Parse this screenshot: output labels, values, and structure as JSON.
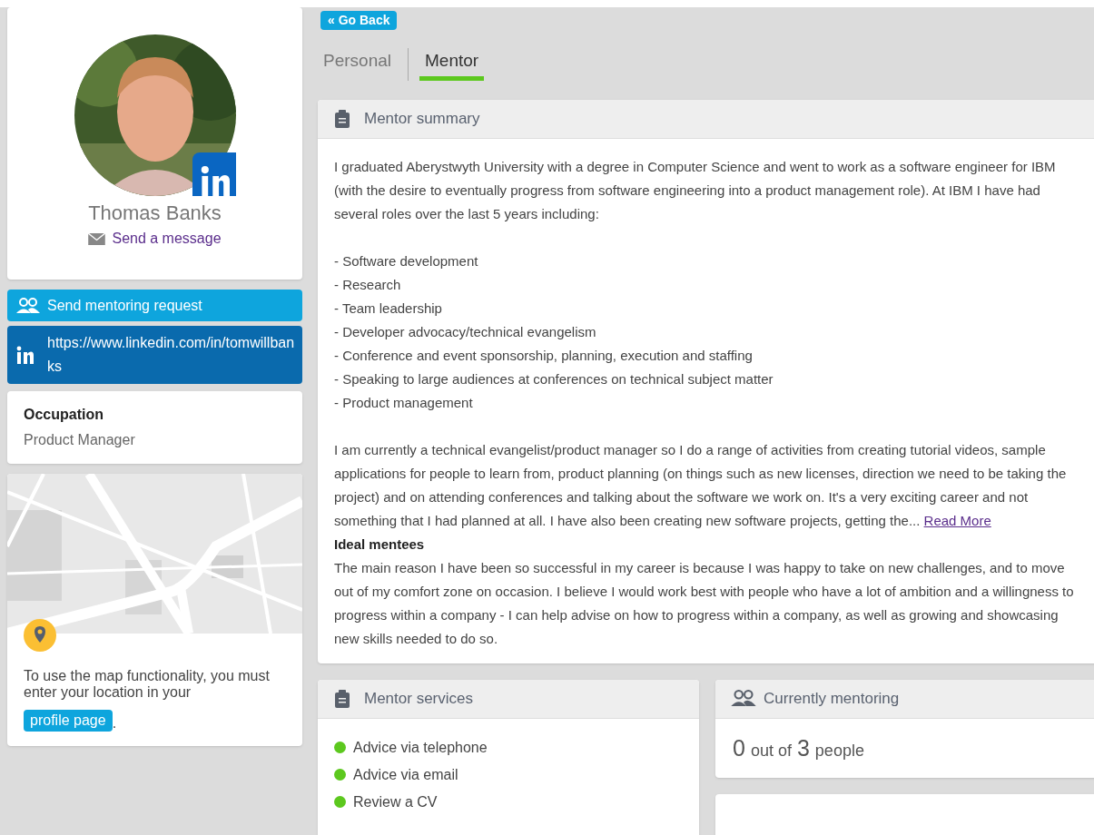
{
  "profile": {
    "name": "Thomas Banks",
    "message_link": "Send a message"
  },
  "mentoring_request_button": "Send mentoring request",
  "linkedin_url": "https://www.linkedin.com/in/tomwillbanks",
  "occupation": {
    "label": "Occupation",
    "value": "Product Manager"
  },
  "map": {
    "notice": "To use the map functionality, you must enter your location in your",
    "link": "profile page",
    "suffix": "."
  },
  "go_back_button": "« Go Back",
  "tabs": [
    {
      "label": "Personal",
      "selected": false
    },
    {
      "label": "Mentor",
      "selected": true
    }
  ],
  "mentor_summary": {
    "title": "Mentor summary",
    "intro": "I graduated Aberystwyth University with a degree in Computer Science and went to work as a software engineer for IBM (with the desire to eventually progress from software engineering into a product management role). At IBM I have had several roles over the last 5 years including:",
    "roles": [
      "- Software development",
      "- Research",
      "- Team leadership",
      "- Developer advocacy/technical evangelism",
      "- Conference and event sponsorship, planning, execution and staffing",
      "- Speaking to large audiences at conferences on technical subject matter",
      "- Product management"
    ],
    "current": "I am currently a technical evangelist/product manager so I do a range of activities from creating tutorial videos, sample applications for people to learn from, product planning (on things such as new licenses, direction we need to be taking the project) and on attending conferences and talking about the software we work on. It's a very exciting career and not something that I had planned at all. I have also been creating new software projects, getting the...",
    "read_more": "Read More",
    "ideal_heading": "Ideal mentees",
    "ideal_text": "The main reason I have been so successful in my career is because I was happy to take on new challenges, and to move out of my comfort zone on occasion. I believe I would work best with people who have a lot of ambition and a willingness to progress within a company - I can help advise on how to progress within a company, as well as growing and showcasing new skills needed to do so."
  },
  "mentor_services": {
    "title": "Mentor services",
    "items": [
      {
        "label": "Advice via telephone",
        "available": true
      },
      {
        "label": "Advice via email",
        "available": true
      },
      {
        "label": "Review a CV",
        "available": true
      }
    ]
  },
  "currently_mentoring": {
    "title": "Currently mentoring",
    "count": "0",
    "out_of": "out of",
    "capacity": "3",
    "unit": "people"
  }
}
